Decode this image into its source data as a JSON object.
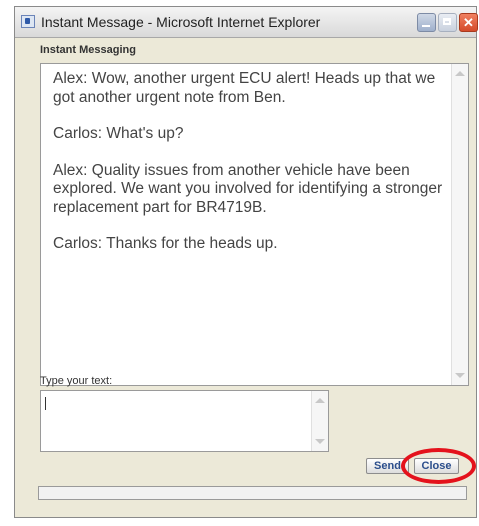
{
  "window": {
    "title": "Instant Message - Microsoft Internet Explorer",
    "title_icon": "ie-page-icon",
    "controls": {
      "minimize": "minimize-icon",
      "maximize": "maximize-icon",
      "close": "close-icon",
      "close_color": "#d44b2b"
    }
  },
  "chat": {
    "heading": "Instant Messaging",
    "messages": [
      "Alex: Wow, another urgent ECU alert!  Heads up that we got another urgent note from Ben.",
      "Carlos: What's up?",
      "Alex: Quality issues from another vehicle have been explored.  We want you involved for identifying a stronger replacement part for BR4719B.",
      "Carlos: Thanks for the heads up."
    ]
  },
  "compose": {
    "label": "Type your text:",
    "value": ""
  },
  "buttons": {
    "send": "Send",
    "close": "Close"
  },
  "annotation": {
    "ring_color": "#e4121c"
  }
}
